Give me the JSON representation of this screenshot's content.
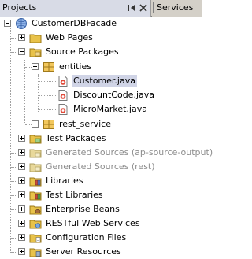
{
  "tabs": {
    "projects_label": "Projects",
    "services_label": "Services"
  },
  "colors": {
    "folder": "#e8c24a",
    "selection": "#d0d4e6",
    "gray_text": "#8c8c8c"
  },
  "tree": {
    "root": "CustomerDBFacade",
    "web_pages": "Web Pages",
    "source_packages": "Source Packages",
    "entities": "entities",
    "customer_java": "Customer.java",
    "discountcode_java": "DiscountCode.java",
    "micromarket_java": "MicroMarket.java",
    "rest_service": "rest_service",
    "test_packages": "Test Packages",
    "generated_ap": "Generated Sources (ap-source-output)",
    "generated_rest": "Generated Sources (rest)",
    "libraries": "Libraries",
    "test_libraries": "Test Libraries",
    "enterprise_beans": "Enterprise Beans",
    "restful_ws": "RESTful Web Services",
    "config_files": "Configuration Files",
    "server_resources": "Server Resources"
  }
}
